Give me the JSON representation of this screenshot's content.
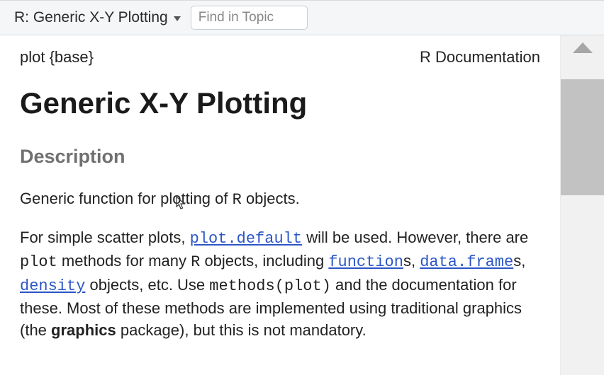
{
  "topbar": {
    "title": "R: Generic X-Y Plotting",
    "search_placeholder": "Find in Topic"
  },
  "meta": {
    "pkg_label": "plot {base}",
    "doc_label": "R Documentation"
  },
  "heading": "Generic X-Y Plotting",
  "sections": {
    "description_head": "Description"
  },
  "para1": {
    "t1": "Generic function for plotting of ",
    "r": "R",
    "t2": " objects."
  },
  "para2": {
    "t1": "For simple scatter plots, ",
    "link_plot_default": "plot.default",
    "t2": " will be used. However, there are ",
    "code_plot": "plot",
    "t3": " methods for many ",
    "r": "R",
    "t4": " objects, including ",
    "link_function": "function",
    "t5": "s, ",
    "link_dataframe": "data.frame",
    "t6": "s, ",
    "link_density": "density",
    "t7": " objects, etc. Use ",
    "code_methods": "methods(plot)",
    "t8": " and the documentation for these. Most of these methods are implemented using traditional graphics (the ",
    "bold_graphics": "graphics",
    "t9": " package), but this is not mandatory."
  }
}
